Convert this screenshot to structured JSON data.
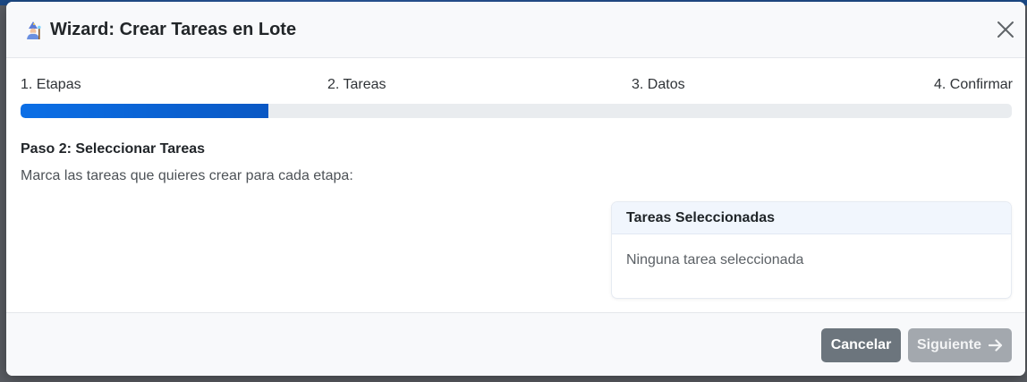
{
  "modal": {
    "title": "Wizard: Crear Tareas en Lote",
    "title_icon": "wizard-mage-icon",
    "close_icon": "close-icon"
  },
  "steps": [
    {
      "label": "1. Etapas"
    },
    {
      "label": "2. Tareas"
    },
    {
      "label": "3. Datos"
    },
    {
      "label": "4. Confirmar"
    }
  ],
  "progress": {
    "percent": 25,
    "fill_color": "#0a63d6",
    "track_color": "#e9ecef"
  },
  "body": {
    "heading": "Paso 2: Seleccionar Tareas",
    "instruction": "Marca las tareas que quieres crear para cada etapa:"
  },
  "selected_panel": {
    "title": "Tareas Seleccionadas",
    "empty_text": "Ninguna tarea seleccionada"
  },
  "footer": {
    "cancel_label": "Cancelar",
    "next_label": "Siguiente",
    "next_icon": "arrow-right-icon",
    "cancel_color": "#6c757d",
    "next_color_disabled": "#a3a8ae"
  }
}
